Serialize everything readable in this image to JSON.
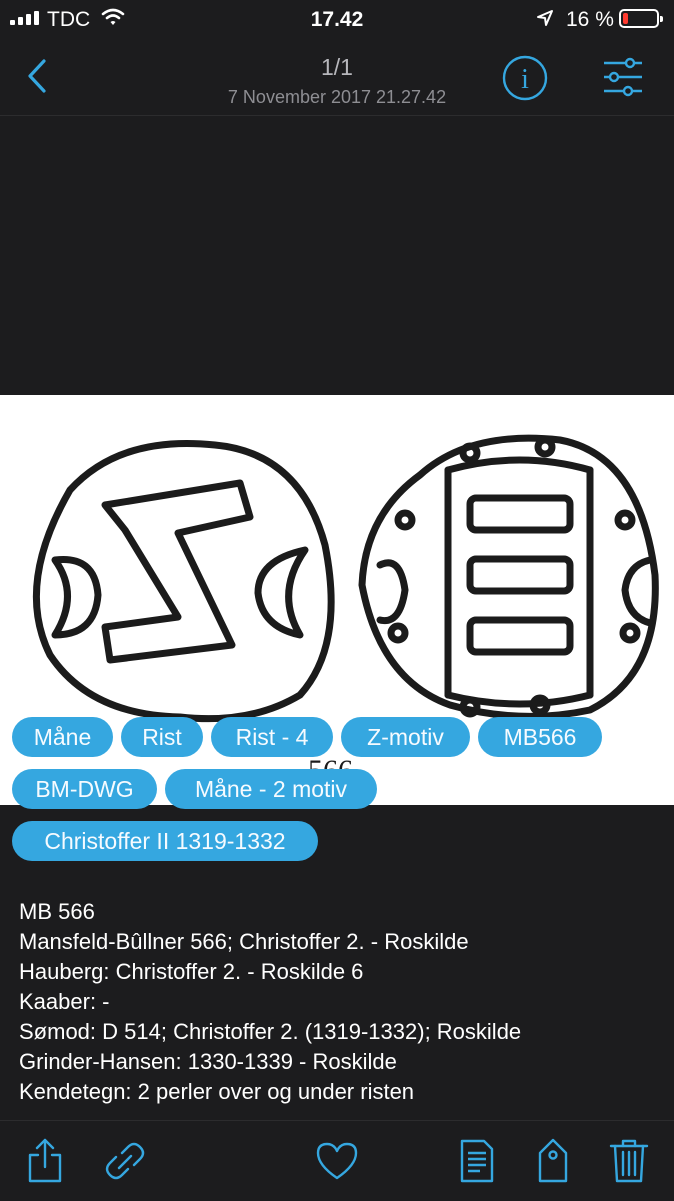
{
  "status_bar": {
    "carrier": "TDC",
    "time": "17.42",
    "battery_percent": "16 %",
    "battery_level": 0.16,
    "battery_color": "#ff3b30"
  },
  "nav": {
    "title": "1/1",
    "subtitle": "7 November 2017  21.27.42",
    "accent_color": "#35a7e0",
    "icons": [
      "back-chevron-icon",
      "info-icon",
      "filter-sliders-icon"
    ]
  },
  "image": {
    "handwritten_text": "566"
  },
  "tags": [
    "Måne",
    "Rist",
    "Rist - 4",
    "Z-motiv",
    "MB566",
    "BM-DWG",
    "Måne - 2 motiv",
    "Christoffer II 1319-1332"
  ],
  "details": [
    "MB 566",
    "Mansfeld-Bûllner 566; Christoffer 2. - Roskilde",
    "Hauberg: Christoffer 2. - Roskilde 6",
    "Kaaber: -",
    "Sømod: D 514; Christoffer 2. (1319-1332); Roskilde",
    "Grinder-Hansen: 1330-1339 - Roskilde",
    "Kendetegn: 2 perler over og under risten"
  ],
  "toolbar": {
    "icons": [
      "share-icon",
      "link-icon",
      "heart-icon",
      "document-icon",
      "tag-icon",
      "trash-icon"
    ]
  }
}
